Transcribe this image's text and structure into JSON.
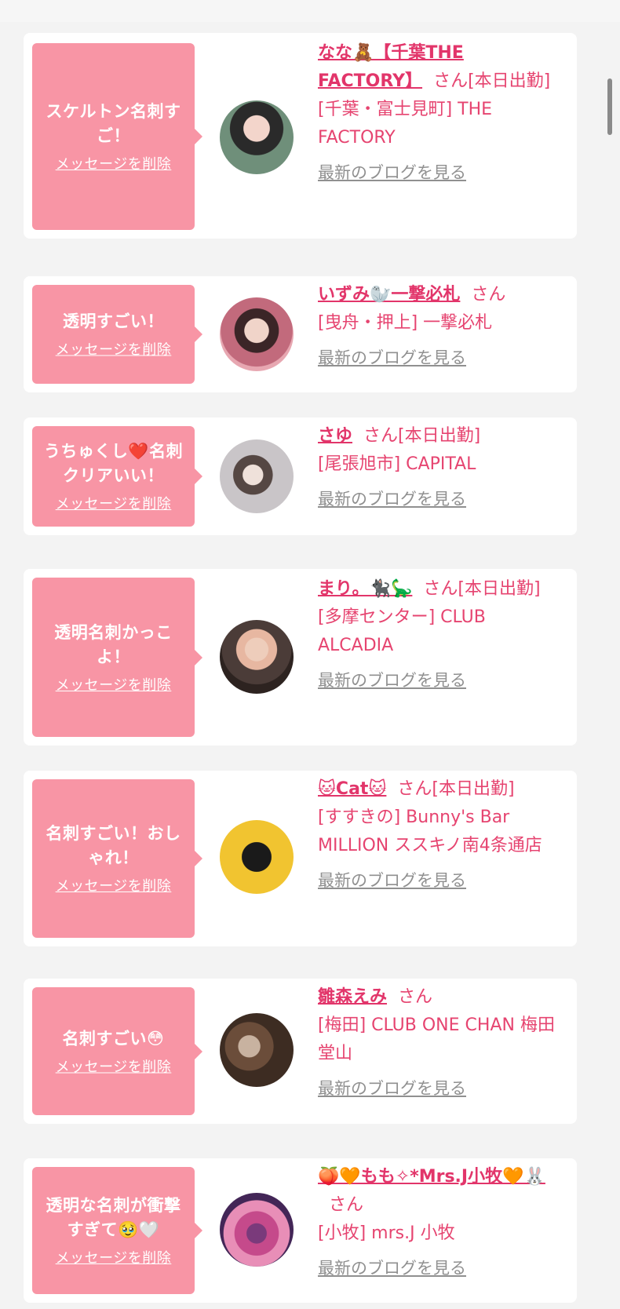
{
  "cards": [
    {
      "message": "スケルトン名刺すご！",
      "delete_label": "メッセージを削除",
      "name": "なな🧸【千葉THE FACTORY】",
      "san": "さん",
      "status": "[本日出勤]",
      "shop": "[千葉・富士見町] THE FACTORY",
      "blog": "最新のブログを見る"
    },
    {
      "message": "透明すごい！",
      "delete_label": "メッセージを削除",
      "name": "いずみ🦭一撃必札",
      "san": "さん",
      "status": "",
      "shop": "[曳舟・押上] 一撃必札",
      "blog": "最新のブログを見る"
    },
    {
      "message": "うちゅくし❤️名刺クリアいい！",
      "delete_label": "メッセージを削除",
      "name": "さゆ",
      "san": "さん",
      "status": "[本日出勤]",
      "shop": "[尾張旭市] CAPITAL",
      "blog": "最新のブログを見る"
    },
    {
      "message": "透明名刺かっこよ！",
      "delete_label": "メッセージを削除",
      "name": "まり。🐈‍⬛🦕",
      "san": "さん",
      "status": "[本日出勤]",
      "shop": "[多摩センター] CLUB ALCADIA",
      "blog": "最新のブログを見る"
    },
    {
      "message": "名刺すごい！おしゃれ！",
      "delete_label": "メッセージを削除",
      "name": "🐱Cat🐱",
      "san": "さん",
      "status": "[本日出勤]",
      "shop": "[すすきの] Bunny's Bar MILLION ススキノ南4条通店",
      "blog": "最新のブログを見る"
    },
    {
      "message": "名刺すごい😳",
      "delete_label": "メッセージを削除",
      "name": "雛森えみ",
      "san": "さん",
      "status": "",
      "shop": "[梅田] CLUB ONE CHAN 梅田堂山",
      "blog": "最新のブログを見る"
    },
    {
      "message": "透明な名刺が衝撃すぎて🥹🤍",
      "delete_label": "メッセージを削除",
      "name": "🍑🧡もも✧*Mrs.J小牧🧡🐰",
      "san": "さん",
      "status": "",
      "shop": "[小牧] mrs.J 小牧",
      "blog": "最新のブログを見る"
    }
  ],
  "colors": {
    "bubble": "#f895a5",
    "accent": "#e2356a",
    "text": "#e64470",
    "link_gray": "#909090",
    "background": "#f3f3f3"
  }
}
